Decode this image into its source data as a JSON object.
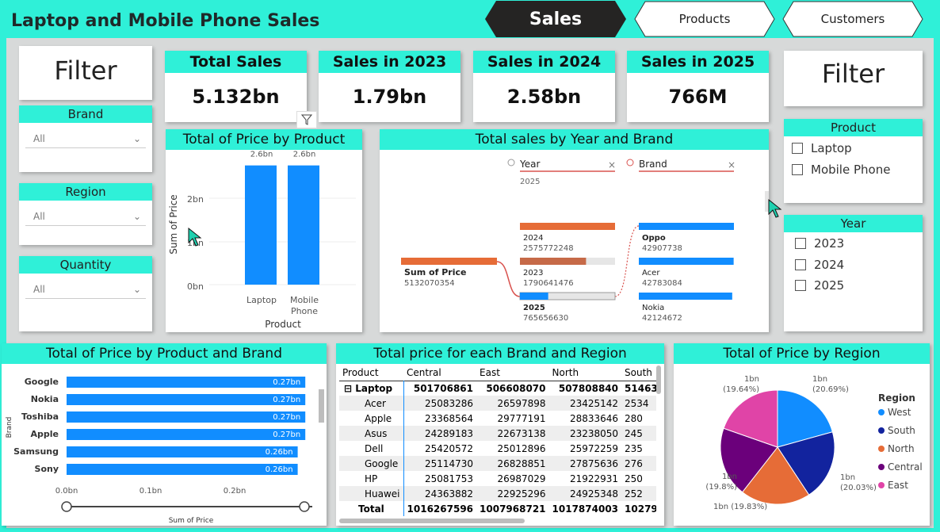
{
  "header": {
    "title": "Laptop and Mobile Phone Sales",
    "tabs": [
      {
        "label": "Sales",
        "active": true
      },
      {
        "label": "Products",
        "active": false
      },
      {
        "label": "Customers",
        "active": false
      }
    ]
  },
  "left_filter": {
    "title": "Filter",
    "slicers": [
      {
        "label": "Brand",
        "value": "All"
      },
      {
        "label": "Region",
        "value": "All"
      },
      {
        "label": "Quantity",
        "value": "All"
      }
    ]
  },
  "kpis": [
    {
      "label": "Total Sales",
      "value": "5.132bn"
    },
    {
      "label": "Sales in 2023",
      "value": "1.79bn"
    },
    {
      "label": "Sales in 2024",
      "value": "2.58bn"
    },
    {
      "label": "Sales in 2025",
      "value": "766M"
    }
  ],
  "right_filter": {
    "title": "Filter",
    "product": {
      "label": "Product",
      "options": [
        "Laptop",
        "Mobile Phone"
      ]
    },
    "year": {
      "label": "Year",
      "options": [
        "2023",
        "2024",
        "2025"
      ]
    }
  },
  "price_by_product": {
    "title": "Total of Price by Product",
    "ylabel": "Sum of Price",
    "xlabel": "Product",
    "yticks": [
      "2bn",
      "1bn",
      "0bn"
    ]
  },
  "decomp_tree": {
    "title": "Total sales by Year and Brand",
    "root": {
      "label": "Sum of Price",
      "value": "5132070354"
    },
    "level1": {
      "header": "Year",
      "selected": "2025",
      "nodes": [
        {
          "label": "2024",
          "value": "2575772248",
          "fraction": 1.0
        },
        {
          "label": "2023",
          "value": "1790641476",
          "fraction": 0.695
        },
        {
          "label": "2025",
          "value": "765656630",
          "fraction": 0.297
        }
      ]
    },
    "level2": {
      "header": "Brand",
      "nodes": [
        {
          "label": "Oppo",
          "value": "42907738",
          "fraction": 1.0
        },
        {
          "label": "Acer",
          "value": "42783084",
          "fraction": 0.997
        },
        {
          "label": "Nokia",
          "value": "42124672",
          "fraction": 0.982
        }
      ]
    }
  },
  "price_by_product_brand": {
    "title": "Total of Price by Product and Brand",
    "ylabel": "Brand",
    "xlabel": "Sum of Price",
    "xticks": [
      "0.0bn",
      "0.1bn",
      "0.2bn"
    ]
  },
  "matrix": {
    "title": "Total price for each Brand and Region",
    "columns": [
      "Product",
      "Central",
      "East",
      "North",
      "South"
    ],
    "group": {
      "label": "Laptop",
      "cells": [
        "501706861",
        "506608070",
        "507808840",
        "51463"
      ]
    },
    "rows": [
      {
        "label": "Acer",
        "cells": [
          "25083286",
          "26597898",
          "23425142",
          "2534"
        ]
      },
      {
        "label": "Apple",
        "cells": [
          "23368564",
          "29777191",
          "28833646",
          "280"
        ]
      },
      {
        "label": "Asus",
        "cells": [
          "24289183",
          "22673138",
          "23238050",
          "245"
        ]
      },
      {
        "label": "Dell",
        "cells": [
          "25420572",
          "25012896",
          "25972259",
          "235"
        ]
      },
      {
        "label": "Google",
        "cells": [
          "25114730",
          "26828851",
          "27875636",
          "276"
        ]
      },
      {
        "label": "HP",
        "cells": [
          "25081753",
          "26987029",
          "21922931",
          "250"
        ]
      },
      {
        "label": "Huawei",
        "cells": [
          "24363882",
          "22925296",
          "24925348",
          "252"
        ]
      }
    ],
    "total": {
      "label": "Total",
      "cells": [
        "1016267596",
        "1007968721",
        "1017874003",
        "10279"
      ]
    }
  },
  "pie": {
    "title": "Total of Price by Region",
    "legend_title": "Region"
  },
  "chart_data": [
    {
      "type": "bar",
      "title": "Total of Price by Product",
      "xlabel": "Product",
      "ylabel": "Sum of Price",
      "categories": [
        "Laptop",
        "Mobile Phone"
      ],
      "values": [
        2.6,
        2.6
      ],
      "data_labels": [
        "2.6bn",
        "2.6bn"
      ],
      "ylim": [
        0,
        2.8
      ],
      "color": "#118dff"
    },
    {
      "type": "bar",
      "orientation": "horizontal",
      "title": "Total of Price by Product and Brand",
      "xlabel": "Sum of Price",
      "ylabel": "Brand",
      "categories": [
        "Google",
        "Nokia",
        "Toshiba",
        "Apple",
        "Samsung",
        "Sony"
      ],
      "values": [
        0.27,
        0.27,
        0.27,
        0.27,
        0.26,
        0.26
      ],
      "data_labels": [
        "0.27bn",
        "0.27bn",
        "0.27bn",
        "0.27bn",
        "0.26bn",
        "0.26bn"
      ],
      "xlim": [
        0,
        0.3
      ],
      "color": "#118dff"
    },
    {
      "type": "pie",
      "title": "Total of Price by Region",
      "legend_title": "Region",
      "slices": [
        {
          "name": "West",
          "value": 20.69,
          "label": "1bn",
          "pct": "(20.69%)",
          "color": "#118dff"
        },
        {
          "name": "South",
          "value": 20.03,
          "label": "1bn",
          "pct": "(20.03%)",
          "color": "#12239e"
        },
        {
          "name": "North",
          "value": 19.83,
          "label": "1bn (19.83%)",
          "pct": "",
          "color": "#e66c37"
        },
        {
          "name": "Central",
          "value": 19.8,
          "label": "1bn",
          "pct": "(19.8%)",
          "color": "#6b007b"
        },
        {
          "name": "East",
          "value": 19.64,
          "label": "1bn",
          "pct": "(19.64%)",
          "color": "#e044a7"
        }
      ]
    }
  ]
}
